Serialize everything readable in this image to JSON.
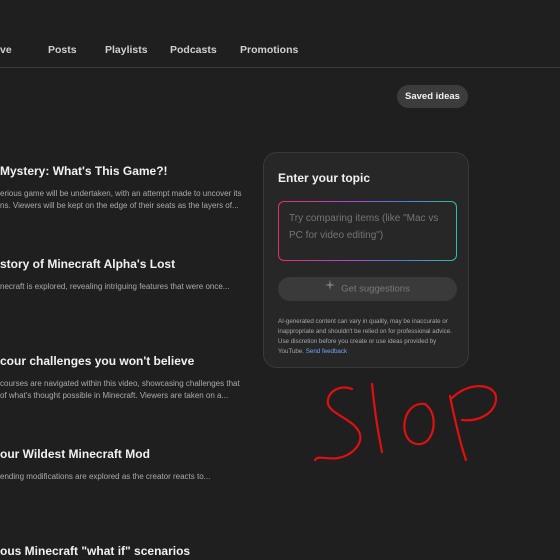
{
  "tabs": [
    {
      "label": "ve"
    },
    {
      "label": "Posts"
    },
    {
      "label": "Playlists"
    },
    {
      "label": "Podcasts"
    },
    {
      "label": "Promotions"
    }
  ],
  "saved_ideas_label": "Saved ideas",
  "ideas": [
    {
      "title": " Mystery: What's This Game?!",
      "desc_lines": [
        "erious game will be undertaken, with an attempt made to uncover its",
        "ns. Viewers will be kept on the edge of their seats as the layers of..."
      ]
    },
    {
      "title": "story of Minecraft Alpha's Lost",
      "desc_lines": [
        "necraft is explored, revealing intriguing features that were once..."
      ]
    },
    {
      "title": "cour challenges you won't believe",
      "desc_lines": [
        " courses are navigated within this video, showcasing challenges that",
        " of what's thought possible in Minecraft. Viewers are taken on a..."
      ]
    },
    {
      "title": "our Wildest Minecraft Mod",
      "desc_lines": [
        "ending modifications are explored as the creator reacts to..."
      ]
    },
    {
      "title": "ous Minecraft \"what if\" scenarios",
      "desc_lines": []
    }
  ],
  "panel": {
    "title": "Enter your topic",
    "placeholder": "Try comparing items (like \"Mac vs PC for video editing\")",
    "button_label": "Get suggestions",
    "button_icon": "sparkle-icon",
    "disclaimer": "AI-generated content can vary in quality, may be inaccurate or inappropriate and shouldn't be relied on for professional advice. Use discretion before you create or use ideas provided by YouTube.",
    "feedback_link": "Send feedback"
  },
  "overlay": {
    "scribble_text": "Slop",
    "scribble_color": "#e01010"
  },
  "colors": {
    "background": "#1f1f1f",
    "panel": "#272727",
    "link": "#6fa8f5"
  }
}
